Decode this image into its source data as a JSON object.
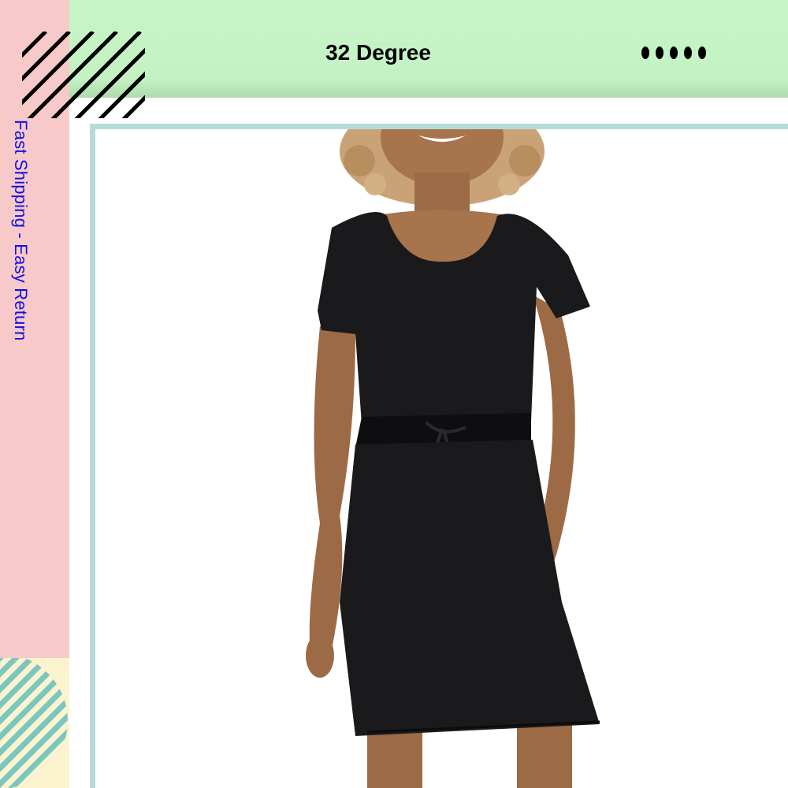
{
  "header": {
    "title": "32 Degree",
    "menu_icon": "dots-menu-icon"
  },
  "sidebar": {
    "tagline": "Fast Shipping - Easy Return"
  },
  "product": {
    "image": "model-black-drawstring-dress-photo"
  },
  "colors": {
    "banner": "#c8f5c8",
    "side_strip": "#f7c9c9",
    "frame_border": "#b6dcd9",
    "tagline_text": "#1010e0",
    "hatch_teal": "#7cc6bf",
    "corner_cream": "#fbf4cf"
  }
}
